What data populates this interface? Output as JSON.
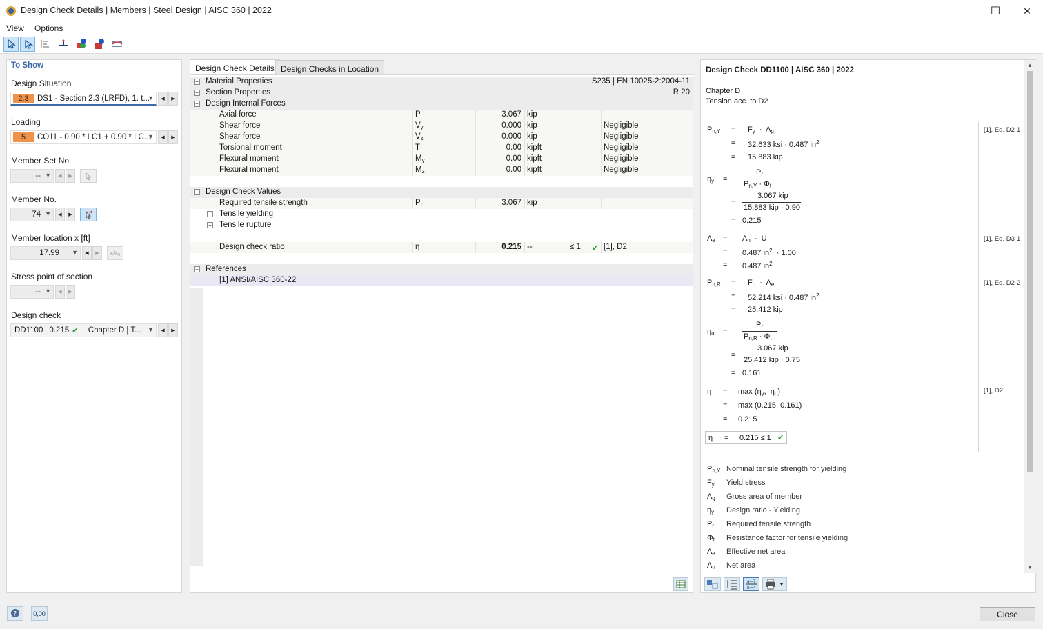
{
  "window": {
    "title": "Design Check Details | Members | Steel Design | AISC 360 | 2022",
    "minimize": "—",
    "maximize": "☐",
    "close": "✕"
  },
  "menu": {
    "view": "View",
    "options": "Options"
  },
  "left": {
    "to_show": "To Show",
    "design_situation_label": "Design Situation",
    "design_situation_badge": "2.3",
    "design_situation_value": "DS1 - Section 2.3 (LRFD), 1. t...",
    "loading_label": "Loading",
    "loading_badge": "5",
    "loading_value": "CO11 - 0.90 * LC1 + 0.90 * LC...",
    "member_set_label": "Member Set No.",
    "member_set_value": "--",
    "member_no_label": "Member No.",
    "member_no_value": "74",
    "member_location_label": "Member location x [ft]",
    "member_location_value": "17.99",
    "member_location_btn": "x/x₀",
    "stress_point_label": "Stress point of section",
    "stress_point_value": "--",
    "design_check_label": "Design check",
    "design_check_id": "DD1100",
    "design_check_ratio": "0.215",
    "design_check_chapter": "Chapter D | T..."
  },
  "tabs": {
    "details": "Design Check Details",
    "location": "Design Checks in Location"
  },
  "center": {
    "material_properties": "Material Properties",
    "material_value": "S235 | EN 10025-2:2004-11",
    "section_properties": "Section Properties",
    "section_value": "R 20",
    "internal_forces": "Design Internal Forces",
    "forces": [
      {
        "name": "Axial force",
        "sym": "P",
        "sub": "",
        "value": "3.067",
        "unit": "kip",
        "note": ""
      },
      {
        "name": "Shear force",
        "sym": "V",
        "sub": "y",
        "value": "0.000",
        "unit": "kip",
        "note": "Negligible"
      },
      {
        "name": "Shear force",
        "sym": "V",
        "sub": "z",
        "value": "0.000",
        "unit": "kip",
        "note": "Negligible"
      },
      {
        "name": "Torsional moment",
        "sym": "T",
        "sub": "",
        "value": "0.00",
        "unit": "kipft",
        "note": "Negligible"
      },
      {
        "name": "Flexural moment",
        "sym": "M",
        "sub": "y",
        "value": "0.00",
        "unit": "kipft",
        "note": "Negligible"
      },
      {
        "name": "Flexural moment",
        "sym": "M",
        "sub": "z",
        "value": "0.00",
        "unit": "kipft",
        "note": "Negligible"
      }
    ],
    "check_values": "Design Check Values",
    "required_tensile": "Required tensile strength",
    "required_sym": "P",
    "required_sub": "r",
    "required_value": "3.067",
    "required_unit": "kip",
    "tensile_yielding": "Tensile yielding",
    "tensile_rupture": "Tensile rupture",
    "ratio_label": "Design check ratio",
    "ratio_sym": "η",
    "ratio_value": "0.215",
    "ratio_unit": "--",
    "ratio_limit": "≤ 1",
    "ratio_ref": "[1], D2",
    "references": "References",
    "ref1": "[1]  ANSI/AISC 360-22"
  },
  "right": {
    "heading": "Design Check DD1100 | AISC 360 | 2022",
    "chapter": "Chapter D",
    "chapter_desc": "Tension acc. to D2",
    "ref_d21": "[1], Eq. D2-1",
    "ref_d31": "[1], Eq. D3-1",
    "ref_d22": "[1], Eq. D2-2",
    "ref_d2": "[1], D2",
    "pny_l2": "32.633 ksi  ·  0.487 in",
    "pny_l3": "15.883 kip",
    "etay_l2_num": "3.067 kip",
    "etay_l2_den": "15.883 kip  ·  0.90",
    "etay_l3": "0.215",
    "ae_l2": "0.487 in",
    "ae_l2b": "·  1.00",
    "ae_l3": "0.487 in",
    "pnr_l2": "52.214 ksi  ·  0.487 in",
    "pnr_l3": "25.412 kip",
    "etau_l2_num": "3.067 kip",
    "etau_l2_den": "25.412 kip  ·  0.75",
    "etau_l3": "0.161",
    "max_l1": "max",
    "max_l2": "max (0.215,  0.161)",
    "max_l3": "0.215",
    "result": "0.215  ≤ 1",
    "legend": [
      {
        "sym": "P",
        "sub": "n,Y",
        "desc": "Nominal tensile strength for yielding"
      },
      {
        "sym": "F",
        "sub": "y",
        "desc": "Yield stress"
      },
      {
        "sym": "A",
        "sub": "g",
        "desc": "Gross area of member"
      },
      {
        "sym": "η",
        "sub": "y",
        "desc": "Design ratio - Yielding"
      },
      {
        "sym": "P",
        "sub": "r",
        "desc": "Required tensile strength"
      },
      {
        "sym": "Φ",
        "sub": "t",
        "desc": "Resistance factor for tensile yielding"
      },
      {
        "sym": "A",
        "sub": "e",
        "desc": "Effective net area"
      },
      {
        "sym": "A",
        "sub": "n",
        "desc": "Net area"
      }
    ]
  },
  "footer": {
    "close": "Close",
    "decimals": "0,00"
  },
  "colors": {
    "badge": "#f0934a",
    "check": "#2e9c3a",
    "accent": "#3c6aa8"
  }
}
